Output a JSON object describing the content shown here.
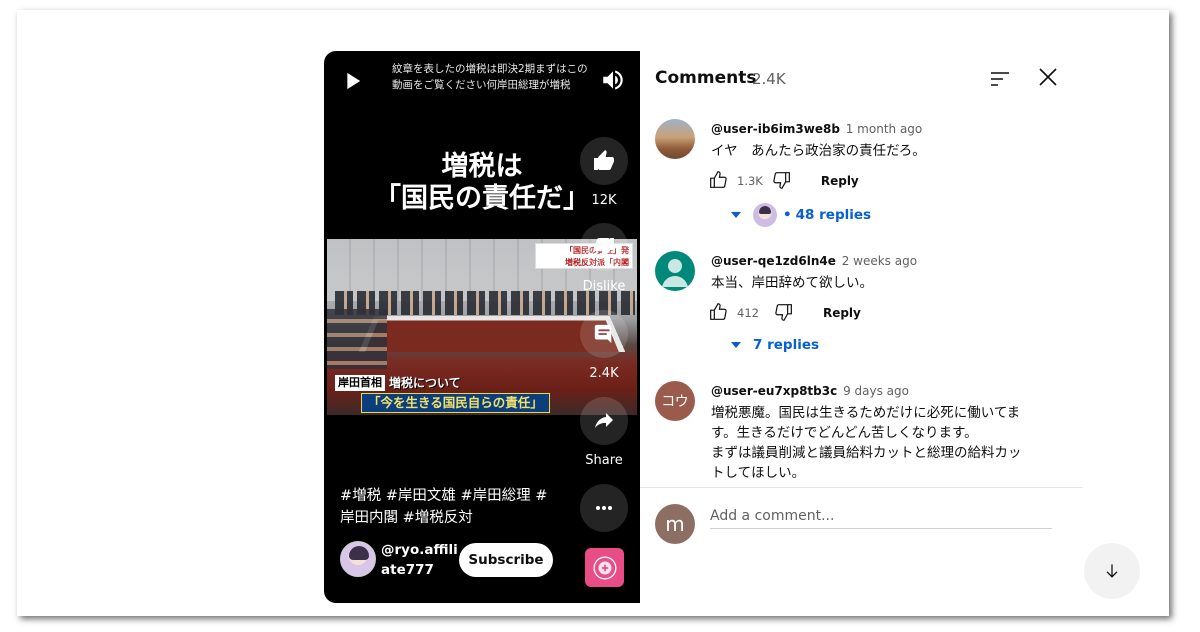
{
  "player": {
    "title": "紋章を表したの増税は即決2期まずはこの動画をご覧ください何岸田総理が増税",
    "caption_line1": "増税は",
    "caption_line2": "「国民の責任だ」",
    "frame_tag_line1": "「国民の責任」発",
    "frame_tag_line2": "増税反対派「内閣",
    "lower_name": "岸田首相",
    "lower_topic": "増税について",
    "lower_quote": "「今を生きる国民自らの責任」",
    "like_count": "12K",
    "dislike_label": "Dislike",
    "comment_count": "2.4K",
    "share_label": "Share",
    "hashtags": "#増税 #岸田文雄 #岸田総理 #岸田内閣 #増税反対",
    "channel": "@ryo.affiliate777",
    "subscribe_label": "Subscribe"
  },
  "comments_panel": {
    "title": "Comments",
    "count": "2.4K",
    "comments": [
      {
        "author": "@user-ib6im3we8b",
        "time": "1 month ago",
        "text": "イヤ　あんたら政治家の責任だろ。",
        "likes": "1.3K",
        "reply_label": "Reply",
        "replies": "48 replies"
      },
      {
        "author": "@user-qe1zd6ln4e",
        "time": "2 weeks ago",
        "text": "本当、岸田辞めて欲しい。",
        "likes": "412",
        "reply_label": "Reply",
        "replies": "7 replies"
      },
      {
        "author": "@user-eu7xp8tb3c",
        "time": "9 days ago",
        "avatar_text": "コウ",
        "text_line1": "増税悪魔。国民は生きるためだけに必死に働いてます。生きるだけでどんどん苦しくなります。",
        "text_line2": "まずは議員削減と議員給料カットと総理の給料カットしてほしい。"
      }
    ],
    "my_avatar_letter": "m",
    "add_comment_placeholder": "Add a comment..."
  },
  "colors": {
    "link_blue": "#065fd4",
    "my_avatar": "#8d6e63",
    "third_avatar": "#9b5b4c",
    "second_avatar": "#00897b",
    "sound_thumb": "#e94d86"
  }
}
